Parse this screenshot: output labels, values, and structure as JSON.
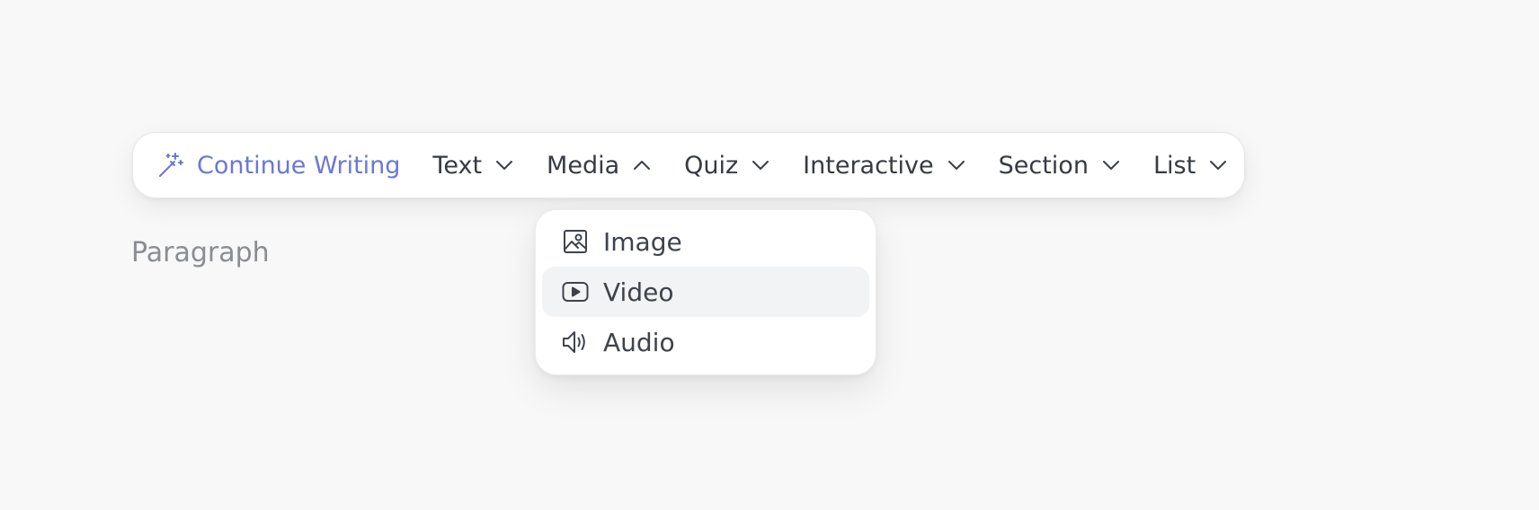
{
  "toolbar": {
    "continue_label": "Continue Writing",
    "menus": [
      {
        "label": "Text",
        "expanded": false
      },
      {
        "label": "Media",
        "expanded": true
      },
      {
        "label": "Quiz",
        "expanded": false
      },
      {
        "label": "Interactive",
        "expanded": false
      },
      {
        "label": "Section",
        "expanded": false
      },
      {
        "label": "List",
        "expanded": false
      }
    ]
  },
  "editor": {
    "placeholder": "Paragraph"
  },
  "media_dropdown": {
    "items": [
      {
        "label": "Image",
        "icon": "image-icon"
      },
      {
        "label": "Video",
        "icon": "video-icon",
        "highlighted": true
      },
      {
        "label": "Audio",
        "icon": "speaker-icon"
      }
    ]
  },
  "colors": {
    "accent": "#6b78d4",
    "text": "#363b43",
    "placeholder": "#8a8d92",
    "hover": "#f2f3f5",
    "background": "#f8f8f8"
  }
}
